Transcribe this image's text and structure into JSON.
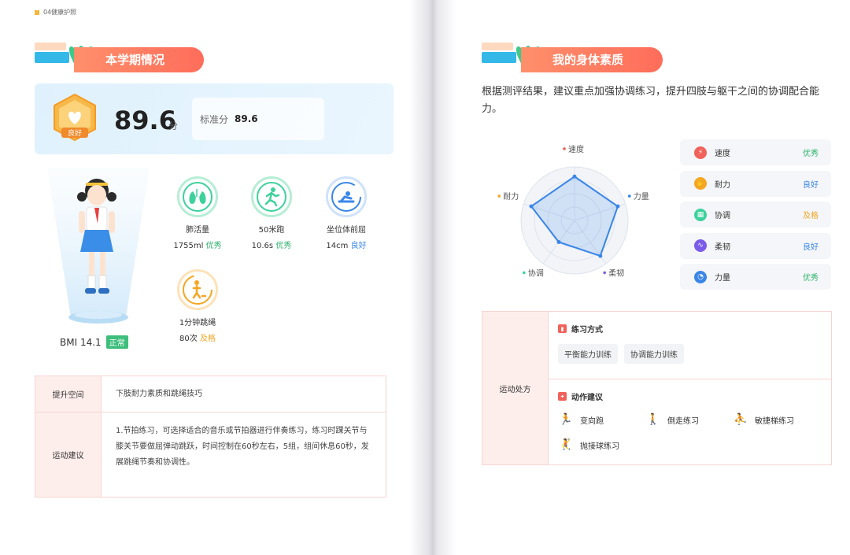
{
  "chapter": "04健康护照",
  "left": {
    "section_title": "本学期情况",
    "badge_label": "良好",
    "score": "89.6",
    "score_unit": "分",
    "standard_label": "标准分",
    "standard_value": "89.6",
    "bmi_label": "BMI 14.1",
    "bmi_status": "正常",
    "metrics": [
      {
        "name": "肺活量",
        "value": "1755ml",
        "level": "优秀",
        "icon": "lungs-icon",
        "color": "#3dd19c",
        "fill": 1.0
      },
      {
        "name": "50米跑",
        "value": "10.6s",
        "level": "优秀",
        "icon": "running-icon",
        "color": "#3dd19c",
        "fill": 1.0
      },
      {
        "name": "坐位体前屈",
        "value": "14cm",
        "level": "良好",
        "icon": "sit-reach-icon",
        "color": "#3a86e8",
        "fill": 0.85
      },
      {
        "name": "1分钟跳绳",
        "value": "80次",
        "level": "及格",
        "icon": "jump-rope-icon",
        "color": "#f5a623",
        "fill": 0.7
      }
    ],
    "table": {
      "row1_head": "提升空间",
      "row1_body": "下肢耐力素质和跳绳技巧",
      "row2_head": "运动建议",
      "row2_body": "1.节拍练习，可选择适合的音乐或节拍器进行伴奏练习，练习时踝关节与膝关节要做屈弹动跳跃，时间控制在60秒左右，5组，组间休息60秒，发展跳绳节奏和协调性。"
    }
  },
  "right": {
    "section_title": "我的身体素质",
    "intro": "根据测评结果，建议重点加强协调练习，提升四肢与躯干之间的协调配合能力。",
    "radar": {
      "axes": [
        "速度",
        "力量",
        "柔韧",
        "协调",
        "耐力"
      ],
      "axis_dot_colors": [
        "#f0625a",
        "#3a86e8",
        "#7b5ce8",
        "#3dd19c",
        "#f5a623"
      ],
      "values": [
        0.82,
        0.85,
        0.82,
        0.5,
        0.85
      ]
    },
    "qualities": [
      {
        "name": "速度",
        "level": "优秀",
        "icon": "lightning-icon",
        "icon_color": "#f0625a",
        "level_color": "#2fb36b"
      },
      {
        "name": "耐力",
        "level": "良好",
        "icon": "endurance-icon",
        "icon_color": "#f5a623",
        "level_color": "#3a86e8"
      },
      {
        "name": "协调",
        "level": "及格",
        "icon": "coordination-icon",
        "icon_color": "#3dd19c",
        "level_color": "#f5a623"
      },
      {
        "name": "柔韧",
        "level": "良好",
        "icon": "flexibility-icon",
        "icon_color": "#7b5ce8",
        "level_color": "#3a86e8"
      },
      {
        "name": "力量",
        "level": "优秀",
        "icon": "strength-icon",
        "icon_color": "#3a86e8",
        "level_color": "#2fb36b"
      }
    ],
    "prescription": {
      "head": "运动处方",
      "method_title": "练习方式",
      "methods": [
        "平衡能力训练",
        "协调能力训练"
      ],
      "action_title": "动作建议",
      "actions": [
        {
          "name": "变向跑",
          "icon": "direction-run-icon"
        },
        {
          "name": "倒走练习",
          "icon": "backward-walk-icon"
        },
        {
          "name": "敏捷梯练习",
          "icon": "agility-ladder-icon"
        },
        {
          "name": "抛接球练习",
          "icon": "ball-toss-icon"
        }
      ]
    }
  }
}
